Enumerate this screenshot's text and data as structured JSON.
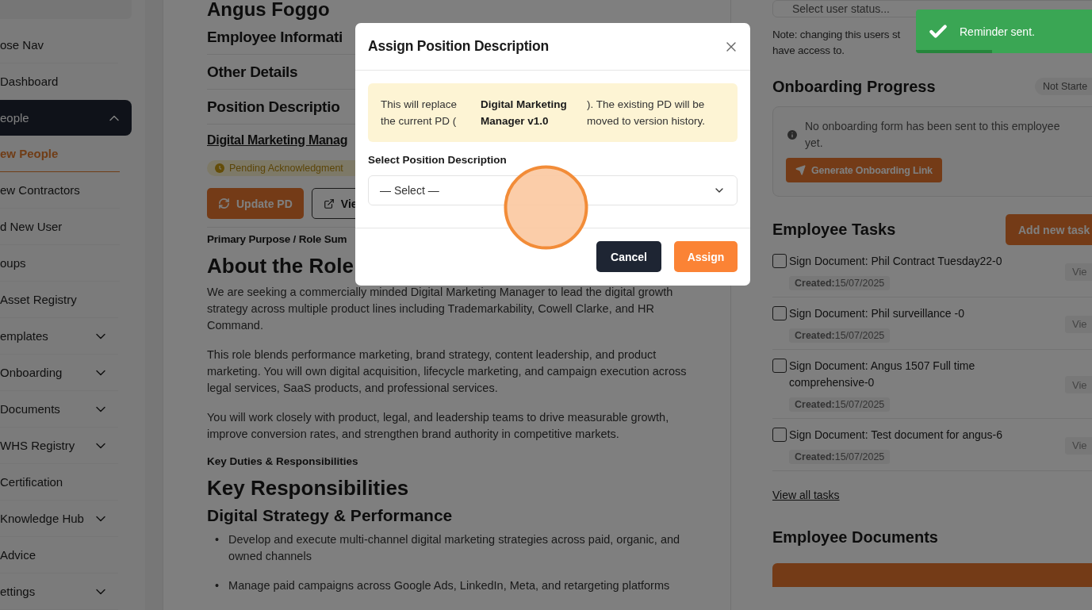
{
  "sidebar": {
    "items": [
      {
        "label": "ose Nav",
        "kind": "plain"
      },
      {
        "label": "Dashboard",
        "kind": "plain"
      },
      {
        "label": "eople",
        "kind": "group",
        "expanded": true,
        "children": [
          {
            "label": "ew People",
            "selected": true
          },
          {
            "label": "ew Contractors",
            "selected": false
          },
          {
            "label": "d New User",
            "selected": false
          },
          {
            "label": "oups",
            "selected": false
          }
        ]
      },
      {
        "label": "Asset Registry",
        "kind": "plain"
      },
      {
        "label": "emplates",
        "kind": "group",
        "expanded": false
      },
      {
        "label": "Onboarding",
        "kind": "group",
        "expanded": false
      },
      {
        "label": "Documents",
        "kind": "group",
        "expanded": false
      },
      {
        "label": "WHS Registry",
        "kind": "group",
        "expanded": false
      },
      {
        "label": "Certification",
        "kind": "plain"
      },
      {
        "label": "Knowledge Hub",
        "kind": "group",
        "expanded": false
      },
      {
        "label": "Advice",
        "kind": "plain"
      },
      {
        "label": "ettings",
        "kind": "group",
        "expanded": false
      }
    ]
  },
  "main": {
    "profile_name": "Angus Foggo",
    "sections": [
      {
        "title": "Employee Informati"
      },
      {
        "title": "Other Details"
      },
      {
        "title": "Position Descriptio"
      }
    ],
    "pd": {
      "title": "Digital Marketing Manag",
      "status": "Pending Acknowledgment",
      "buttons": [
        {
          "label": "Update PD",
          "kind": "primary"
        },
        {
          "label": "Vie",
          "kind": "outline"
        }
      ],
      "summary_label": "Primary Purpose / Role Sum"
    },
    "content": [
      {
        "kind": "h2",
        "text": "About the Role"
      },
      {
        "kind": "p",
        "text": "We are seeking a commercially minded Digital Marketing Manager to lead the digital growth strategy across multiple product lines including Trademarkability, Cowell Clarke, and HR Command."
      },
      {
        "kind": "p",
        "text": "This role blends performance marketing, brand strategy, content leadership, and product marketing. You will own digital acquisition, lifecycle marketing, and campaign execution across legal services, SaaS products, and professional services."
      },
      {
        "kind": "p",
        "text": "You will work closely with product, legal, and leadership teams to drive measurable growth, improve conversion rates, and strengthen brand authority in competitive markets."
      },
      {
        "kind": "label",
        "text": "Key Duties & Responsibilities"
      },
      {
        "kind": "h2",
        "text": "Key Responsibilities"
      },
      {
        "kind": "h3",
        "text": "Digital Strategy & Performance"
      },
      {
        "kind": "bullet",
        "marker": "•",
        "text": "Develop and execute multi-channel digital marketing strategies across paid, organic, and owned channels"
      },
      {
        "kind": "bullet",
        "marker": "•",
        "text": "Manage paid campaigns across Google Ads, LinkedIn, Meta, and retargeting platforms"
      }
    ]
  },
  "right": {
    "status_field": {
      "placeholder": "Select user status..."
    },
    "note": [
      "Note: changing this users st",
      "have access to."
    ],
    "onboarding": {
      "title": "Onboarding Progress",
      "status": "Not Starte",
      "message": "No onboarding form has been sent to this employee yet.",
      "button": "Generate Onboarding Link"
    },
    "tasks": {
      "title": "Employee Tasks",
      "add_button": "Add new task",
      "items": [
        {
          "title": "Sign Document: Phil Contract Tuesday22-0",
          "created_label": "Created:",
          "created_date": "15/07/2025",
          "checked": false,
          "view": "Vie"
        },
        {
          "title": "Sign Document: Phil surveillance -0",
          "created_label": "Created:",
          "created_date": "15/07/2025",
          "checked": false,
          "view": "Vie"
        },
        {
          "title": "Sign Document: Angus 1507 Full time comprehensive-0",
          "created_label": "Created:",
          "created_date": "15/07/2025",
          "checked": false,
          "view": "Vie"
        },
        {
          "title": "Sign Document: Test document for angus-6",
          "created_label": "Created:",
          "created_date": "15/07/2025",
          "checked": false,
          "view": "Vie"
        }
      ],
      "view_all": "View all tasks"
    },
    "documents": {
      "title": "Employee Documents"
    }
  },
  "modal": {
    "title": "Assign Position Description",
    "notice": {
      "lead": "This will replace the current PD (",
      "current_pd": "Digital Marketing Manager v1.0",
      "tail": "). The existing PD will be moved to version history."
    },
    "field_label": "Select Position Description",
    "select": {
      "value": "— Select —"
    },
    "buttons": [
      {
        "label": "Cancel",
        "kind": "secondary"
      },
      {
        "label": "Assign",
        "kind": "primary"
      }
    ]
  },
  "toast": {
    "message": "Reminder sent.",
    "level": 0.4
  }
}
